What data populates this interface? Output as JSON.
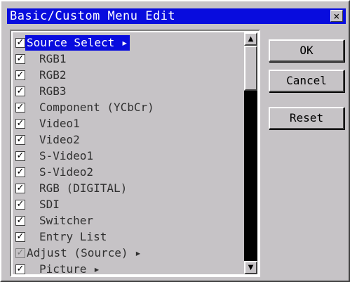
{
  "window": {
    "title": "Basic/Custom Menu Edit",
    "close_glyph": "×"
  },
  "menu_list": {
    "items": [
      {
        "label": "Source Select ▸",
        "checked": true,
        "level": 0,
        "selected": true,
        "enabled": true
      },
      {
        "label": "RGB1",
        "checked": true,
        "level": 1,
        "selected": false,
        "enabled": true
      },
      {
        "label": "RGB2",
        "checked": true,
        "level": 1,
        "selected": false,
        "enabled": true
      },
      {
        "label": "RGB3",
        "checked": true,
        "level": 1,
        "selected": false,
        "enabled": true
      },
      {
        "label": "Component (YCbCr)",
        "checked": true,
        "level": 1,
        "selected": false,
        "enabled": true
      },
      {
        "label": "Video1",
        "checked": true,
        "level": 1,
        "selected": false,
        "enabled": true
      },
      {
        "label": "Video2",
        "checked": true,
        "level": 1,
        "selected": false,
        "enabled": true
      },
      {
        "label": "S-Video1",
        "checked": true,
        "level": 1,
        "selected": false,
        "enabled": true
      },
      {
        "label": "S-Video2",
        "checked": true,
        "level": 1,
        "selected": false,
        "enabled": true
      },
      {
        "label": "RGB (DIGITAL)",
        "checked": true,
        "level": 1,
        "selected": false,
        "enabled": true
      },
      {
        "label": "SDI",
        "checked": true,
        "level": 1,
        "selected": false,
        "enabled": true
      },
      {
        "label": "Switcher",
        "checked": true,
        "level": 1,
        "selected": false,
        "enabled": true
      },
      {
        "label": "Entry List",
        "checked": true,
        "level": 1,
        "selected": false,
        "enabled": true
      },
      {
        "label": "Adjust (Source) ▸",
        "checked": true,
        "level": 0,
        "selected": false,
        "enabled": false
      },
      {
        "label": "Picture ▸",
        "checked": true,
        "level": 1,
        "selected": false,
        "enabled": true
      }
    ],
    "check_glyph": "✓",
    "scroll_up_glyph": "▲",
    "scroll_down_glyph": "▼"
  },
  "buttons": {
    "ok": "OK",
    "cancel": "Cancel",
    "reset": "Reset"
  },
  "colors": {
    "title_bar": "#080cde",
    "selection": "#080cde",
    "face": "#c6c3c6"
  }
}
